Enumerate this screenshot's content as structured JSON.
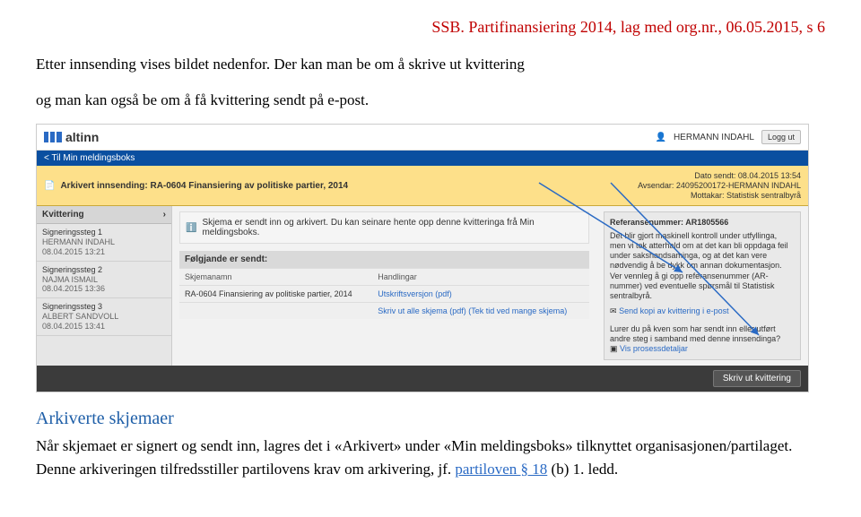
{
  "doc": {
    "header": "SSB. Partifinansiering 2014, lag med org.nr., 06.05.2015, s 6",
    "intro1": "Etter innsending vises bildet nedenfor. Der kan man be om å skrive ut kvittering",
    "intro2": "og man kan også be om å få kvittering sendt på e-post.",
    "section_title": "Arkiverte skjemaer",
    "body1a": "Når skjemaet er signert og sendt inn, lagres det i «Arkivert» under «Min meldingsboks» tilknyttet organisasjonen/partilaget. Denne arkiveringen tilfredsstiller partilovens krav om arkivering, jf. ",
    "body1b": "partiloven § 18",
    "body1c": " (b) 1. ledd."
  },
  "ui": {
    "logo_text": "altinn",
    "username": "HERMANN INDAHL",
    "logout": "Logg ut",
    "backlink": "< Til Min meldingsboks",
    "archive_title": "Arkivert innsending: RA-0604 Finansiering av politiske partier, 2014",
    "meta_sent": "Dato sendt: 08.04.2015 13:54",
    "meta_sender": "Avsendar: 24095200172-HERMANN INDAHL",
    "meta_receiver": "Mottakar: Statistisk sentralbyrå",
    "side_hdr": "Kvittering",
    "steps": [
      {
        "title": "Signeringssteg 1",
        "name": "HERMANN INDAHL",
        "ts": "08.04.2015 13:21"
      },
      {
        "title": "Signeringssteg 2",
        "name": "NAJMA ISMAIL",
        "ts": "08.04.2015 13:36"
      },
      {
        "title": "Signeringssteg 3",
        "name": "ALBERT SANDVOLL",
        "ts": "08.04.2015 13:41"
      }
    ],
    "info_text": "Skjema er sendt inn og arkivert. Du kan seinare hente opp denne kvitteringa frå Min meldingsboks.",
    "sent_hdr": "Følgjande er sendt:",
    "col_name": "Skjemanamn",
    "col_action": "Handlingar",
    "row_name": "RA-0604 Finansiering av politiske partier, 2014",
    "row_link": "Utskriftsversjon (pdf)",
    "print_all": "Skriv ut alle skjema (pdf) (Tek tid ved mange skjema)",
    "ref_hdr": "Referansenummer: AR1805566",
    "ref_body": "Det blir gjort maskinell kontroll under utfyllinga, men vi tek atterhald om at det kan bli oppdaga feil under sakshandsaminga, og at det kan vere nødvendig å be dykk om annan dokumentasjon. Ver vennleg å gi opp referansenummer (AR-nummer) ved eventuelle spørsmål til Statistisk sentralbyrå.",
    "send_copy": "Send kopi av kvittering i e-post",
    "wonder": "Lurer du på kven som har sendt inn eller utført andre steg i samband med denne innsendinga?",
    "show_details": "Vis prosessdetaljar",
    "print_btn": "Skriv ut kvittering"
  }
}
